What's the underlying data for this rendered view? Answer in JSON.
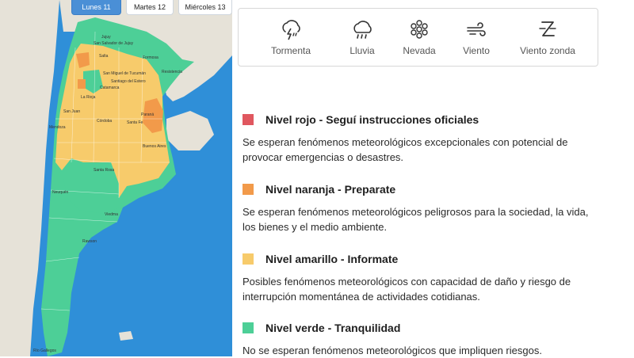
{
  "map": {
    "tabs": [
      {
        "label": "Lunes 11",
        "active": true
      },
      {
        "label": "Martes 12",
        "active": false
      },
      {
        "label": "Miércoles 13",
        "active": false
      }
    ],
    "place_labels": [
      "Jujuy",
      "San Salvador de Jujuy",
      "Salta",
      "Formosa",
      "San Miguel de Tucumán",
      "Santiago del Estero",
      "Catamarca",
      "Resistencia",
      "La Rioja",
      "San Juan",
      "Mendoza",
      "Córdoba",
      "Paraná",
      "Santa Fe",
      "Santa Rosa",
      "Buenos Aires",
      "Neuquén",
      "Viedma",
      "Rawson",
      "Río Gallegos"
    ],
    "colors": {
      "sea": "#2f8fd8",
      "land": "#e6e2d8",
      "red": "#e0575f",
      "orange": "#f29a4a",
      "yellow": "#f7cb6b",
      "green": "#4dcf97"
    }
  },
  "phenomena": [
    {
      "label": "Tormenta",
      "icon": "storm-icon"
    },
    {
      "label": "Lluvia",
      "icon": "rain-icon"
    },
    {
      "label": "Nevada",
      "icon": "snow-icon"
    },
    {
      "label": "Viento",
      "icon": "wind-icon"
    },
    {
      "label": "Viento zonda",
      "icon": "zonda-wind-icon"
    }
  ],
  "levels": [
    {
      "color": "#e0575f",
      "title": "Nivel rojo - Seguí instrucciones oficiales",
      "description": "Se esperan fenómenos meteorológicos excepcionales con potencial de provocar emergencias o desastres."
    },
    {
      "color": "#f29a4a",
      "title": "Nivel naranja - Preparate",
      "description": "Se esperan fenómenos meteorológicos peligrosos para la sociedad, la vida, los bienes y el medio ambiente."
    },
    {
      "color": "#f7cb6b",
      "title": "Nivel amarillo - Informate",
      "description": "Posibles fenómenos meteorológicos con capacidad de daño y riesgo de interrupción momentánea de actividades cotidianas."
    },
    {
      "color": "#4dcf97",
      "title": "Nivel verde - Tranquilidad",
      "description": "No se esperan fenómenos meteorológicos que impliquen riesgos."
    }
  ]
}
